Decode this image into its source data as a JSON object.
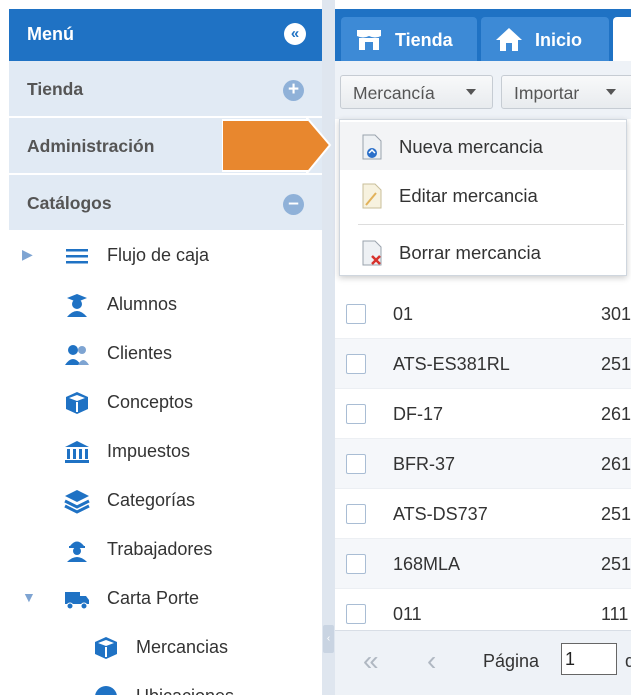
{
  "sidebar": {
    "title": "Menú",
    "collapse_icon": "double-chevron-left-icon",
    "sections": [
      {
        "label": "Tienda",
        "toggle": "+"
      },
      {
        "label": "Administración"
      },
      {
        "label": "Catálogos",
        "toggle": "–"
      }
    ],
    "items": [
      {
        "label": "Flujo de caja",
        "icon": "list-icon"
      },
      {
        "label": "Alumnos",
        "icon": "student-icon"
      },
      {
        "label": "Clientes",
        "icon": "users-icon"
      },
      {
        "label": "Conceptos",
        "icon": "box-icon"
      },
      {
        "label": "Impuestos",
        "icon": "bank-icon"
      },
      {
        "label": "Categorías",
        "icon": "layers-icon"
      },
      {
        "label": "Trabajadores",
        "icon": "worker-icon"
      },
      {
        "label": "Carta Porte",
        "icon": "truck-icon"
      },
      {
        "label": "Mercancias",
        "icon": "box-icon"
      },
      {
        "label": "Ubicaciones",
        "icon": "globe-icon"
      }
    ]
  },
  "tabs": [
    {
      "label": "Tienda",
      "icon": "store-icon"
    },
    {
      "label": "Inicio",
      "icon": "home-icon"
    }
  ],
  "toolbar": {
    "mercancia_label": "Mercancía",
    "importar_label": "Importar"
  },
  "menu": {
    "items": [
      {
        "label": "Nueva mercancia",
        "icon": "new-document-icon"
      },
      {
        "label": "Editar mercancia",
        "icon": "edit-document-icon"
      },
      {
        "label": "Borrar mercancia",
        "icon": "delete-document-icon"
      }
    ]
  },
  "grid": {
    "rows": [
      {
        "code": "01",
        "col2": "301"
      },
      {
        "code": "ATS-ES381RL",
        "col2": "251"
      },
      {
        "code": "DF-17",
        "col2": "261"
      },
      {
        "code": "BFR-37",
        "col2": "261"
      },
      {
        "code": "ATS-DS737",
        "col2": "251"
      },
      {
        "code": "168MLA",
        "col2": "251"
      },
      {
        "code": "011",
        "col2": "111"
      }
    ]
  },
  "pager": {
    "page_label": "Página",
    "page_value": "1",
    "of_label": "d"
  },
  "colors": {
    "primary": "#1f72c4",
    "section_bg": "#e1eaf4",
    "highlight_arrow": "#e8872e"
  }
}
